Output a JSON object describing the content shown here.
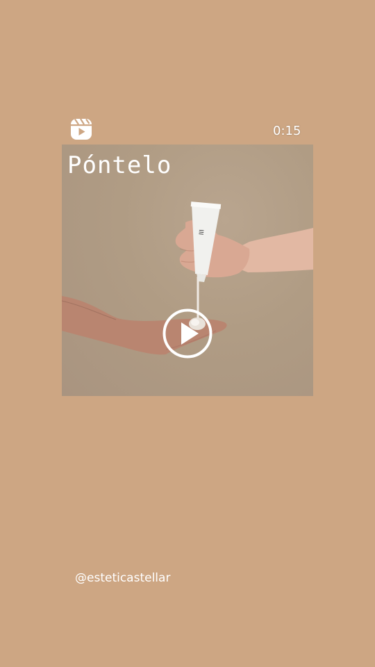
{
  "reel": {
    "icon": "reels-icon",
    "duration": "0:15",
    "overlay_text": "Póntelo",
    "play_icon": "play-icon",
    "author_handle": "@esteticastellar"
  },
  "colors": {
    "background": "#cda683",
    "video_background": "#b09c84",
    "text": "#ffffff"
  }
}
